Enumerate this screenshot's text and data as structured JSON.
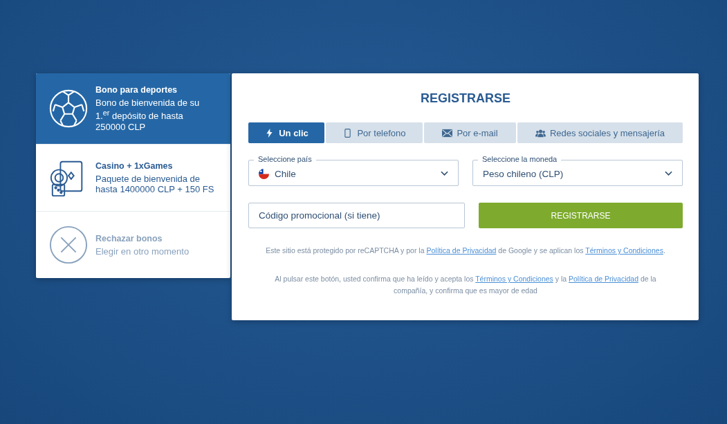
{
  "bonuses": [
    {
      "kind": "sports",
      "title": "Bono para deportes",
      "text": "Bono de bienvenida de su 1.$^{er}$ depósito de hasta 250000 CLP",
      "selected": true,
      "disabled": false
    },
    {
      "kind": "casino",
      "title": "Casino + 1xGames",
      "text": "Paquete de bienvenida de hasta 1400000 CLP + 150 FS",
      "selected": false,
      "disabled": false
    },
    {
      "kind": "decline",
      "title": "Rechazar bonos",
      "text": "Elegir en otro momento",
      "selected": false,
      "disabled": true
    }
  ],
  "form": {
    "title": "REGISTRARSE",
    "tabs": [
      {
        "kind": "bolt",
        "label": "Un clic",
        "selected": true
      },
      {
        "kind": "phone",
        "label": "Por telefono",
        "selected": false
      },
      {
        "kind": "mail",
        "label": "Por e-mail",
        "selected": false
      },
      {
        "kind": "people",
        "label": "Redes sociales y mensajería",
        "selected": false
      }
    ],
    "country": {
      "label": "Seleccione país",
      "value": "Chile"
    },
    "currency": {
      "label": "Seleccione la moneda",
      "value": "Peso chileno (CLP)"
    },
    "promo": {
      "placeholder": "Código promocional (si tiene)"
    },
    "submit": "REGISTRARSE",
    "notes": [
      [
        {
          "kind": "text",
          "text": "Este sitio está protegido por reCAPTCHA y por la "
        },
        {
          "kind": "link",
          "text": "Política de Privacidad"
        },
        {
          "kind": "text",
          "text": " de Google y se aplican los "
        },
        {
          "kind": "link",
          "text": "Términos y Condiciones"
        },
        {
          "kind": "text",
          "text": "."
        }
      ],
      [
        {
          "kind": "text",
          "text": "Al pulsar este botón, usted confirma que ha leído y acepta los "
        },
        {
          "kind": "link",
          "text": "Términos y Condiciones"
        },
        {
          "kind": "text",
          "text": " y la "
        },
        {
          "kind": "link",
          "text": "Política de Privacidad"
        },
        {
          "kind": "text",
          "text": " de la compañía, y confirma que es mayor de edad"
        }
      ]
    ]
  }
}
